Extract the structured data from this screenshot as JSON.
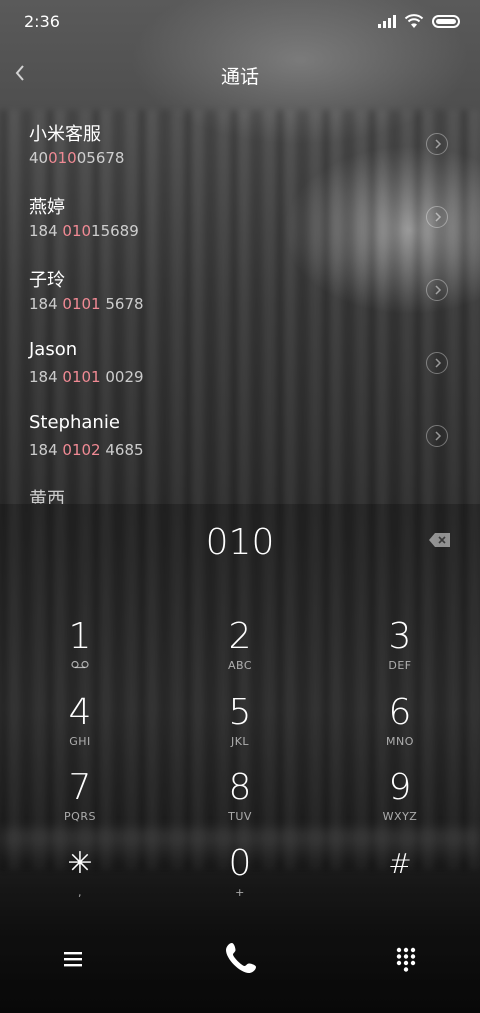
{
  "status_bar": {
    "time": "2:36"
  },
  "header": {
    "title": "通话"
  },
  "contacts": [
    {
      "name": "小米客服",
      "number_pre": "40",
      "number_hl": "010",
      "number_post": "05678"
    },
    {
      "name": "燕婷",
      "number_pre": "184 ",
      "number_hl": "010",
      "number_post": "15689"
    },
    {
      "name": "子玲",
      "number_pre": "184 ",
      "number_hl": "0101",
      "number_post": " 5678"
    },
    {
      "name": "Jason",
      "number_pre": "184 ",
      "number_hl": "0101",
      "number_post": " 0029"
    },
    {
      "name": "Stephanie",
      "number_pre": "184 ",
      "number_hl": "0102",
      "number_post": " 4685"
    },
    {
      "name": "黄西",
      "number_pre": "",
      "number_hl": "",
      "number_post": ""
    }
  ],
  "dialer": {
    "entered_number": "010",
    "keys": [
      {
        "digit": "1",
        "letters": ""
      },
      {
        "digit": "2",
        "letters": "ABC"
      },
      {
        "digit": "3",
        "letters": "DEF"
      },
      {
        "digit": "4",
        "letters": "GHI"
      },
      {
        "digit": "5",
        "letters": "JKL"
      },
      {
        "digit": "6",
        "letters": "MNO"
      },
      {
        "digit": "7",
        "letters": "PQRS"
      },
      {
        "digit": "8",
        "letters": "TUV"
      },
      {
        "digit": "9",
        "letters": "WXYZ"
      },
      {
        "digit": "✳",
        "letters": ","
      },
      {
        "digit": "0",
        "letters": "+"
      },
      {
        "digit": "#",
        "letters": ""
      }
    ]
  },
  "icons": {
    "back": "chevron-left-icon",
    "voicemail": "voicemail-icon",
    "backspace": "backspace-icon",
    "menu": "menu-icon",
    "call": "phone-icon",
    "dialpad": "dialpad-icon"
  },
  "colors": {
    "highlight": "#f08a94"
  }
}
